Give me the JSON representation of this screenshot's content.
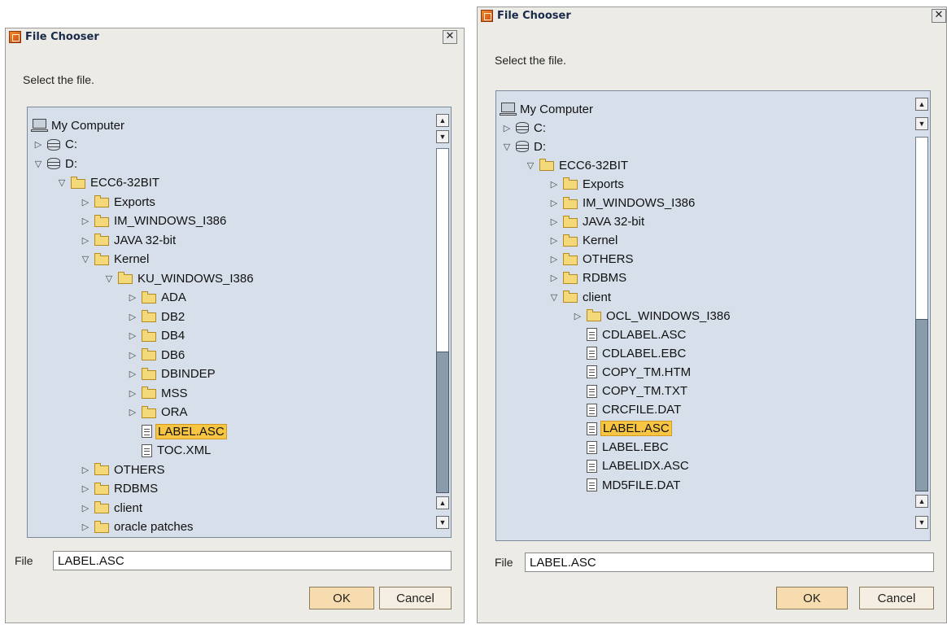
{
  "dialogs": [
    {
      "title": "File Chooser",
      "prompt": "Select the file.",
      "tree": [
        {
          "label": "My Computer",
          "icon": "computer-icon",
          "level": 0,
          "expander": "none"
        },
        {
          "label": "C:",
          "icon": "drive-icon",
          "level": 0,
          "expander": "collapsed"
        },
        {
          "label": "D:",
          "icon": "drive-icon",
          "level": 0,
          "expander": "expanded"
        },
        {
          "label": "ECC6-32BIT",
          "icon": "folder-icon",
          "level": 1,
          "expander": "expanded"
        },
        {
          "label": "Exports",
          "icon": "folder-icon",
          "level": 2,
          "expander": "collapsed"
        },
        {
          "label": "IM_WINDOWS_I386",
          "icon": "folder-icon",
          "level": 2,
          "expander": "collapsed"
        },
        {
          "label": "JAVA 32-bit",
          "icon": "folder-icon",
          "level": 2,
          "expander": "collapsed"
        },
        {
          "label": "Kernel",
          "icon": "folder-icon",
          "level": 2,
          "expander": "expanded"
        },
        {
          "label": "KU_WINDOWS_I386",
          "icon": "folder-icon",
          "level": 3,
          "expander": "expanded"
        },
        {
          "label": "ADA",
          "icon": "folder-icon",
          "level": 4,
          "expander": "collapsed"
        },
        {
          "label": "DB2",
          "icon": "folder-icon",
          "level": 4,
          "expander": "collapsed"
        },
        {
          "label": "DB4",
          "icon": "folder-icon",
          "level": 4,
          "expander": "collapsed"
        },
        {
          "label": "DB6",
          "icon": "folder-icon",
          "level": 4,
          "expander": "collapsed"
        },
        {
          "label": "DBINDEP",
          "icon": "folder-icon",
          "level": 4,
          "expander": "collapsed"
        },
        {
          "label": "MSS",
          "icon": "folder-icon",
          "level": 4,
          "expander": "collapsed"
        },
        {
          "label": "ORA",
          "icon": "folder-icon",
          "level": 4,
          "expander": "collapsed"
        },
        {
          "label": "LABEL.ASC",
          "icon": "file-icon",
          "level": 4,
          "expander": "none",
          "selected": true
        },
        {
          "label": "TOC.XML",
          "icon": "file-icon",
          "level": 4,
          "expander": "none"
        },
        {
          "label": "OTHERS",
          "icon": "folder-icon",
          "level": 2,
          "expander": "collapsed"
        },
        {
          "label": "RDBMS",
          "icon": "folder-icon",
          "level": 2,
          "expander": "collapsed"
        },
        {
          "label": "client",
          "icon": "folder-icon",
          "level": 2,
          "expander": "collapsed"
        },
        {
          "label": "oracle patches",
          "icon": "folder-icon",
          "level": 2,
          "expander": "collapsed"
        }
      ],
      "file_label": "File",
      "file_value": "LABEL.ASC",
      "ok_label": "OK",
      "cancel_label": "Cancel",
      "close_glyph": "✕"
    },
    {
      "title": "File Chooser",
      "prompt": "Select the file.",
      "tree": [
        {
          "label": "My Computer",
          "icon": "computer-icon",
          "level": 0,
          "expander": "none"
        },
        {
          "label": "C:",
          "icon": "drive-icon",
          "level": 0,
          "expander": "collapsed"
        },
        {
          "label": "D:",
          "icon": "drive-icon",
          "level": 0,
          "expander": "expanded"
        },
        {
          "label": "ECC6-32BIT",
          "icon": "folder-icon",
          "level": 1,
          "expander": "expanded"
        },
        {
          "label": "Exports",
          "icon": "folder-icon",
          "level": 2,
          "expander": "collapsed"
        },
        {
          "label": "IM_WINDOWS_I386",
          "icon": "folder-icon",
          "level": 2,
          "expander": "collapsed"
        },
        {
          "label": "JAVA 32-bit",
          "icon": "folder-icon",
          "level": 2,
          "expander": "collapsed"
        },
        {
          "label": "Kernel",
          "icon": "folder-icon",
          "level": 2,
          "expander": "collapsed"
        },
        {
          "label": "OTHERS",
          "icon": "folder-icon",
          "level": 2,
          "expander": "collapsed"
        },
        {
          "label": "RDBMS",
          "icon": "folder-icon",
          "level": 2,
          "expander": "collapsed"
        },
        {
          "label": "client",
          "icon": "folder-icon",
          "level": 2,
          "expander": "expanded"
        },
        {
          "label": "OCL_WINDOWS_I386",
          "icon": "folder-icon",
          "level": 3,
          "expander": "collapsed"
        },
        {
          "label": "CDLABEL.ASC",
          "icon": "file-icon",
          "level": 3,
          "expander": "none"
        },
        {
          "label": "CDLABEL.EBC",
          "icon": "file-icon",
          "level": 3,
          "expander": "none"
        },
        {
          "label": "COPY_TM.HTM",
          "icon": "file-icon",
          "level": 3,
          "expander": "none"
        },
        {
          "label": "COPY_TM.TXT",
          "icon": "file-icon",
          "level": 3,
          "expander": "none"
        },
        {
          "label": "CRCFILE.DAT",
          "icon": "file-icon",
          "level": 3,
          "expander": "none"
        },
        {
          "label": "LABEL.ASC",
          "icon": "file-icon",
          "level": 3,
          "expander": "none",
          "selected": true
        },
        {
          "label": "LABEL.EBC",
          "icon": "file-icon",
          "level": 3,
          "expander": "none"
        },
        {
          "label": "LABELIDX.ASC",
          "icon": "file-icon",
          "level": 3,
          "expander": "none"
        },
        {
          "label": "MD5FILE.DAT",
          "icon": "file-icon",
          "level": 3,
          "expander": "none"
        }
      ],
      "file_label": "File",
      "file_value": "LABEL.ASC",
      "ok_label": "OK",
      "cancel_label": "Cancel",
      "close_glyph": "✕"
    }
  ]
}
